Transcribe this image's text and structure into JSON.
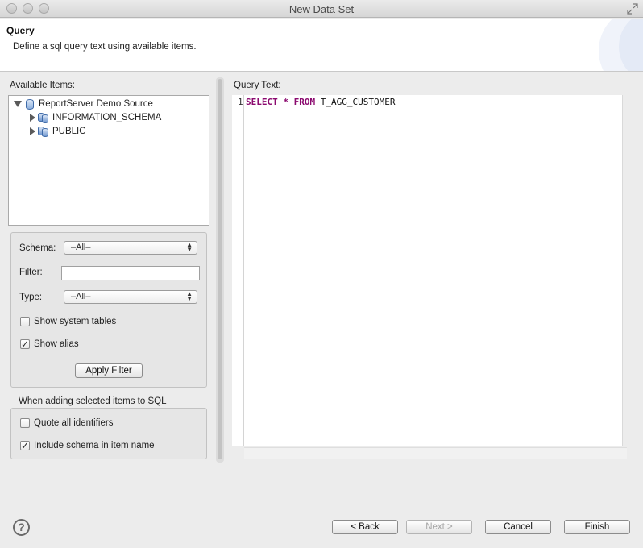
{
  "window": {
    "title": "New Data Set"
  },
  "header": {
    "title": "Query",
    "description": "Define a sql query text using available items."
  },
  "available_items": {
    "label": "Available Items:",
    "tree": [
      {
        "label": "ReportServer Demo Source",
        "expanded": true,
        "icon": "database-icon"
      },
      {
        "label": "INFORMATION_SCHEMA",
        "expanded": false,
        "icon": "schema-icon"
      },
      {
        "label": "PUBLIC",
        "expanded": false,
        "icon": "schema-icon"
      }
    ]
  },
  "filter": {
    "schema_label": "Schema:",
    "schema_value": "–All–",
    "filter_label": "Filter:",
    "filter_value": "",
    "type_label": "Type:",
    "type_value": "–All–",
    "show_system_tables": {
      "label": "Show system tables",
      "checked": false
    },
    "show_alias": {
      "label": "Show alias",
      "checked": true
    },
    "apply_label": "Apply Filter"
  },
  "sql_options": {
    "label": "When adding selected items to SQL",
    "quote_identifiers": {
      "label": "Quote all identifiers",
      "checked": false
    },
    "include_schema": {
      "label": "Include schema in item name",
      "checked": true
    }
  },
  "query": {
    "label": "Query Text:",
    "line_number": "1",
    "tokens": {
      "select": "SELECT",
      "star": "*",
      "from": "FROM",
      "table": "T_AGG_CUSTOMER"
    }
  },
  "footer": {
    "back_label": "< Back",
    "next_label": "Next >",
    "cancel_label": "Cancel",
    "finish_label": "Finish"
  },
  "colors": {
    "keyword": "#8b0a6f"
  }
}
